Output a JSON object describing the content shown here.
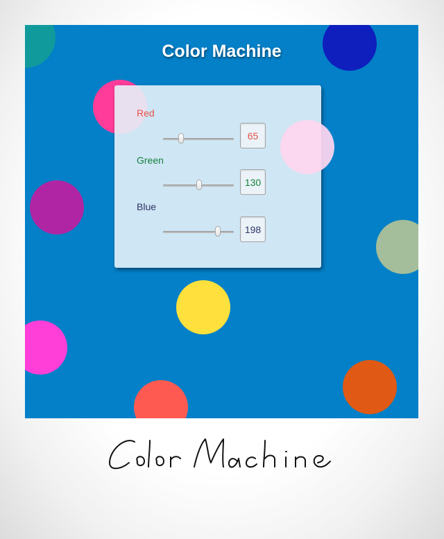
{
  "app": {
    "title": "Color Machine"
  },
  "controls": {
    "red": {
      "label": "Red",
      "value": "65",
      "fraction": 0.255,
      "color": "#e8524a"
    },
    "green": {
      "label": "Green",
      "value": "130",
      "fraction": 0.51,
      "color": "#15803d"
    },
    "blue": {
      "label": "Blue",
      "value": "198",
      "fraction": 0.776,
      "color": "#2c3466"
    }
  },
  "colors": {
    "stage_background": "#0380c8",
    "dots": [
      "#109a9c",
      "#0f1fbd",
      "#ff3c99",
      "#ffd6ef",
      "#b025a3",
      "#a4bd9a",
      "#ffe03c",
      "#ff3fd8",
      "#ff5a52",
      "#e05a15"
    ]
  },
  "caption": {
    "text": "Color Machine"
  }
}
